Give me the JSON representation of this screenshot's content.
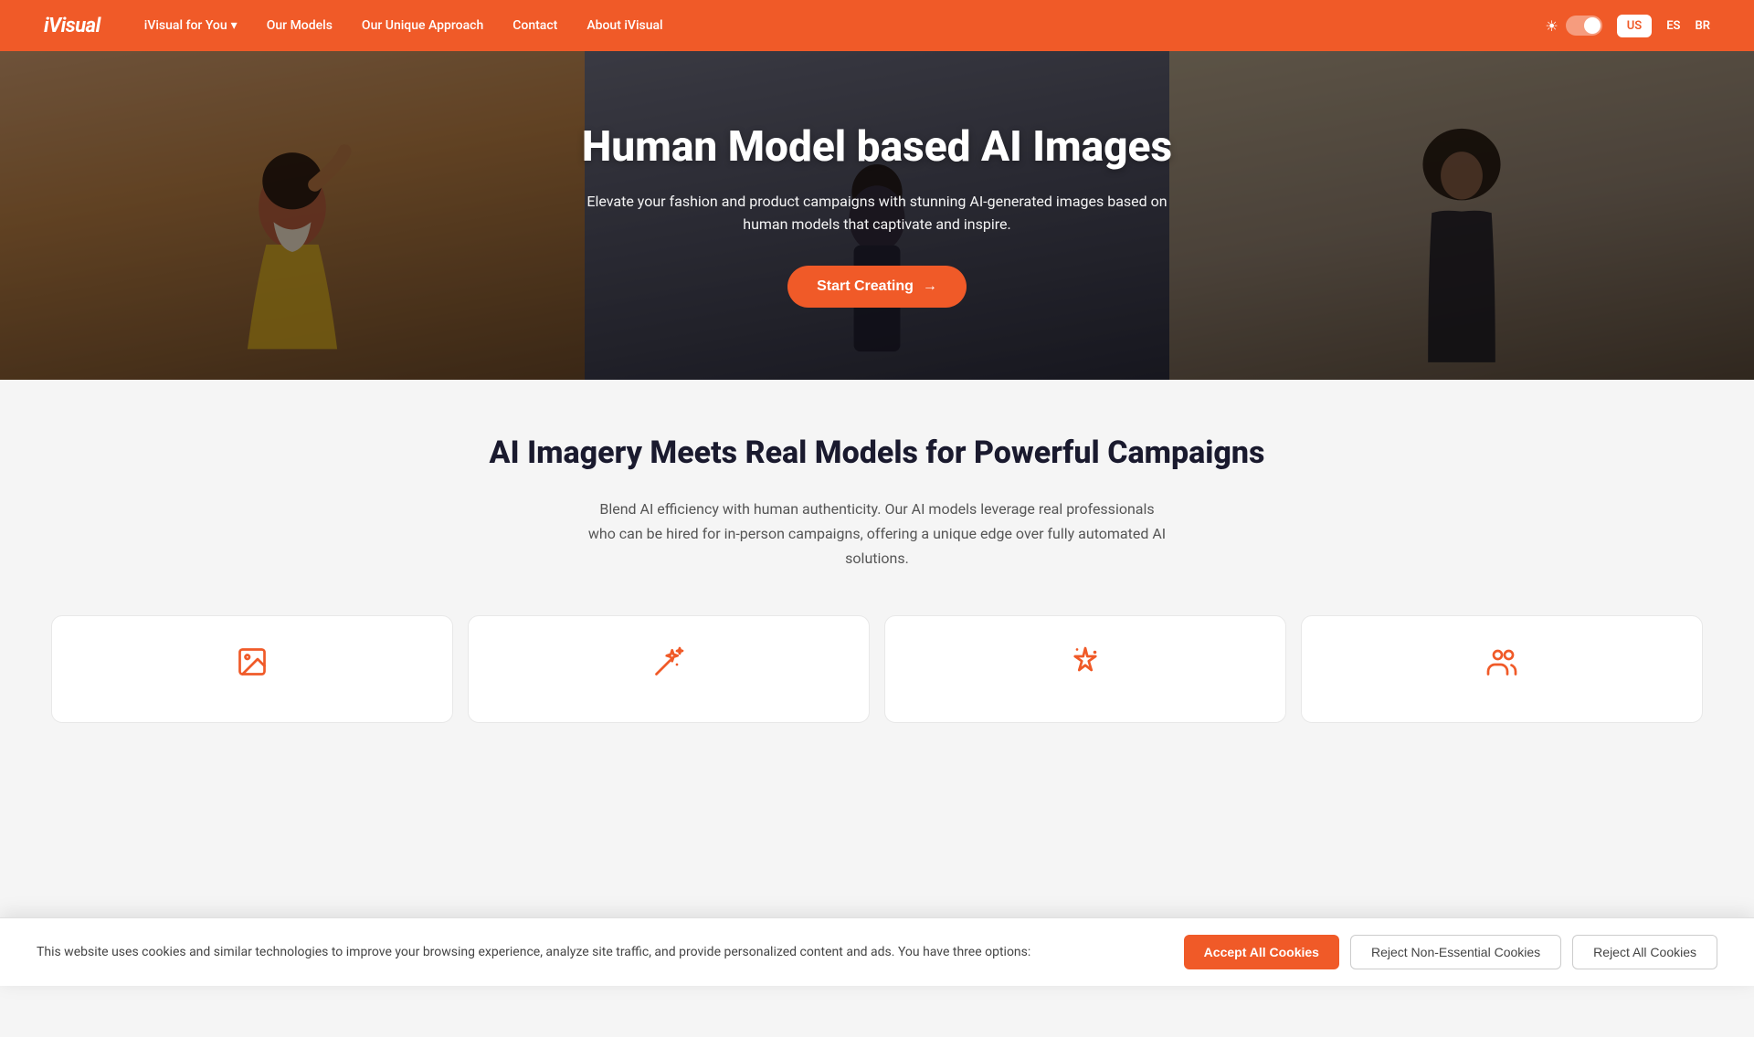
{
  "nav": {
    "logo": "iVisual",
    "links": [
      {
        "label": "iVisual for You",
        "hasDropdown": true
      },
      {
        "label": "Our Models"
      },
      {
        "label": "Our Unique Approach"
      },
      {
        "label": "Contact"
      },
      {
        "label": "About iVisual"
      }
    ],
    "languages": [
      {
        "code": "US",
        "active": true
      },
      {
        "code": "ES",
        "active": false
      },
      {
        "code": "BR",
        "active": false
      }
    ]
  },
  "hero": {
    "title": "Human Model based AI Images",
    "subtitle": "Elevate your fashion and product campaigns with stunning AI-generated images based on human models that captivate and inspire.",
    "cta_label": "Start Creating",
    "cta_arrow": "→"
  },
  "section2": {
    "title": "AI Imagery Meets Real Models for Powerful Campaigns",
    "text": "Blend AI efficiency with human authenticity. Our AI models leverage real professionals who can be hired for in-person campaigns, offering a unique edge over fully automated AI solutions."
  },
  "features": [
    {
      "icon": "🖼",
      "icon_name": "image-icon"
    },
    {
      "icon": "✨",
      "icon_name": "magic-icon"
    },
    {
      "icon": "⭐",
      "icon_name": "star-icon"
    },
    {
      "icon": "👥",
      "icon_name": "people-icon"
    }
  ],
  "cookie_banner": {
    "text": "This website uses cookies and similar technologies to improve your browsing experience, analyze site traffic, and provide personalized content and ads. You have three options:",
    "accept_label": "Accept All Cookies",
    "reject_non_label": "Reject Non-Essential Cookies",
    "reject_all_label": "Reject All Cookies"
  }
}
